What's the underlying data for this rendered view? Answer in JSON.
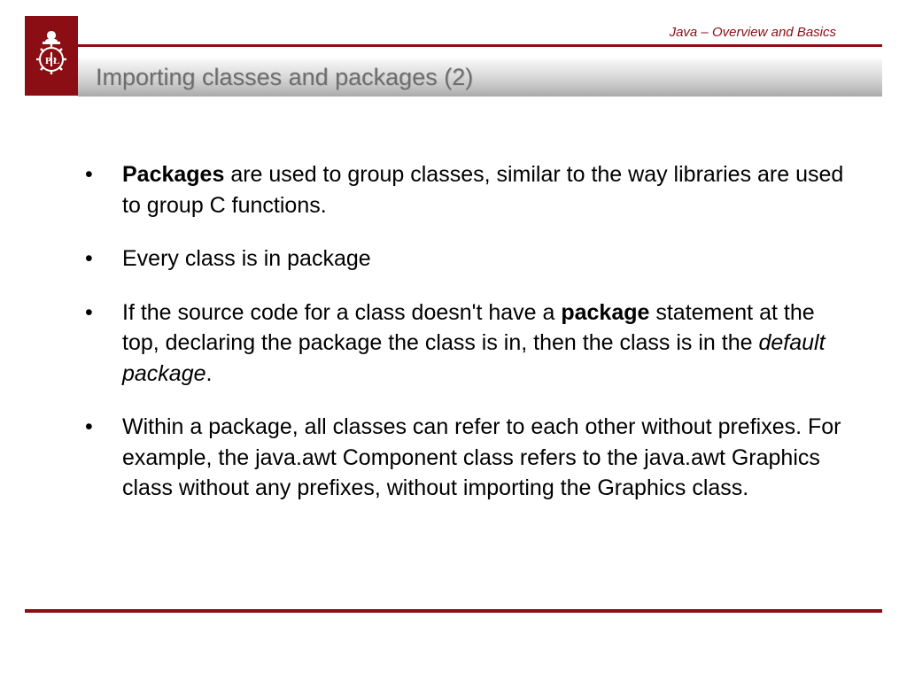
{
  "colors": {
    "accent": "#8b0e14"
  },
  "header": {
    "course": "Java – Overview and Basics",
    "title": "Importing classes and packages (2)"
  },
  "bullets": {
    "b1_bold": "Packages",
    "b1_rest": " are used to group classes, similar to the way libraries are used to group C functions.",
    "b2": "Every class is in package",
    "b3_a": "If the source code for a class doesn't have a ",
    "b3_bold": "package",
    "b3_b": " statement at the top, declaring the package the class is in, then the class is in the ",
    "b3_italic": "default package",
    "b3_c": ".",
    "b4": "Within a package, all classes can refer to each other without prefixes. For example, the java.awt Component class refers to the java.awt Graphics class without any prefixes, without importing the Graphics class."
  }
}
